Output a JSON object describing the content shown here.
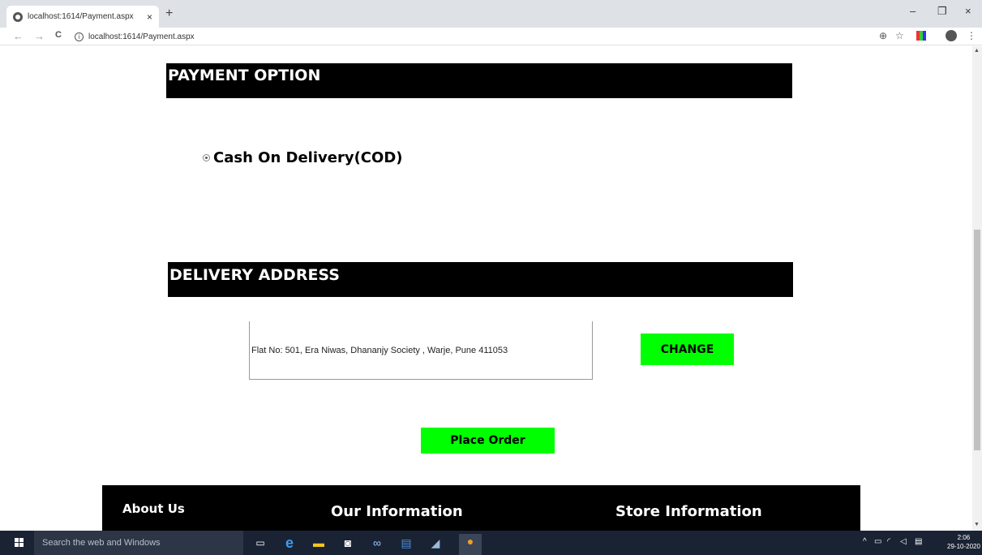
{
  "browser": {
    "tab_title": "localhost:1614/Payment.aspx",
    "tab_close": "×",
    "new_tab": "+",
    "minimize": "–",
    "restore": "❐",
    "close": "×",
    "back": "←",
    "forward": "→",
    "reload": "C",
    "address": "localhost:1614/Payment.aspx",
    "zoom_icon": "⊕",
    "star_icon": "☆",
    "menu_icon": "⋮"
  },
  "payment": {
    "header": "PAYMENT OPTION",
    "option_label": "Cash On Delivery(COD)",
    "option_selected": true
  },
  "delivery": {
    "header": "DELIVERY ADDRESS",
    "address": "Flat No: 501, Era Niwas, Dhananjy Society , Warje, Pune 411053",
    "change_button": "CHANGE"
  },
  "place_order_button": "Place Order",
  "footer": {
    "about": "About Us",
    "our_info": "Our Information",
    "store_info": "Store Information"
  },
  "taskbar": {
    "search_placeholder": "Search the web and Windows",
    "time": "2:06",
    "date": "29-10-2020"
  },
  "colors": {
    "header_bg": "#000000",
    "button_green": "#00ff00",
    "taskbar_bg": "#1a2333"
  }
}
